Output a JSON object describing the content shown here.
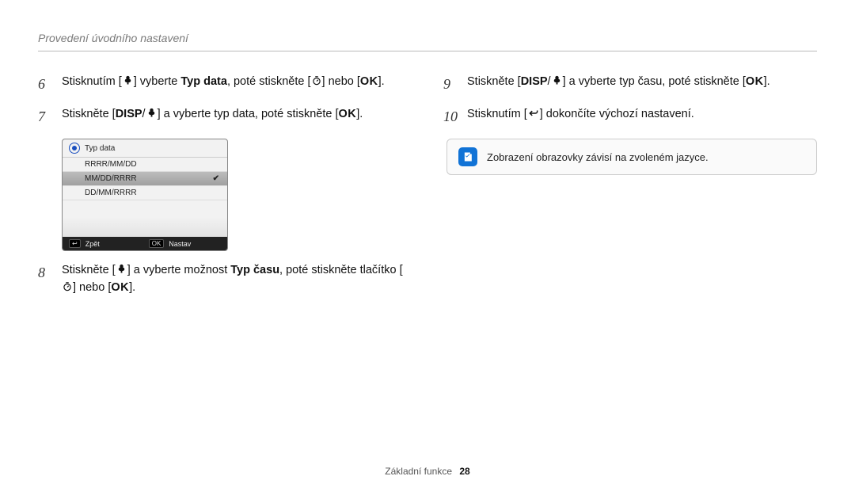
{
  "header": {
    "title": "Provedení úvodního nastavení"
  },
  "left": {
    "steps": [
      {
        "num": "6",
        "pre": "Stisknutím [",
        "icon": "macro",
        "mid": "] vyberte ",
        "bold": "Typ data",
        "post": ", poté stiskněte [",
        "icon2": "timer",
        "post2": "] nebo [",
        "ok": "OK",
        "post3": "]."
      },
      {
        "num": "7",
        "pre": "Stiskněte [",
        "disp": "DISP",
        "slash": "/",
        "icon": "macro",
        "mid": "] a vyberte typ data, poté stiskněte [",
        "ok": "OK",
        "post3": "]."
      },
      {
        "num": "8",
        "pre": "Stiskněte [",
        "icon": "macro",
        "mid": "] a vyberte možnost ",
        "bold": "Typ času",
        "post": ", poté stiskněte tlačítko [",
        "icon2": "timer",
        "post2": "] nebo [",
        "ok": "OK",
        "post3": "]."
      }
    ],
    "lcd": {
      "title": "Typ data",
      "rows": [
        "RRRR/MM/DD",
        "MM/DD/RRRR",
        "DD/MM/RRRR"
      ],
      "selected_index": 1,
      "foot_back_icon": "↩",
      "foot_back": "Zpět",
      "foot_ok_box": "OK",
      "foot_set": "Nastav"
    }
  },
  "right": {
    "steps": [
      {
        "num": "9",
        "pre": "Stiskněte [",
        "disp": "DISP",
        "slash": "/",
        "icon": "macro",
        "mid": "] a vyberte typ času, poté stiskněte [",
        "ok": "OK",
        "post3": "]."
      },
      {
        "num": "10",
        "pre": "Stisknutím [",
        "icon": "back",
        "mid": "] dokončíte výchozí nastavení."
      }
    ],
    "note": "Zobrazení obrazovky závisí na zvoleném jazyce."
  },
  "footer": {
    "section": "Základní funkce",
    "page": "28"
  }
}
